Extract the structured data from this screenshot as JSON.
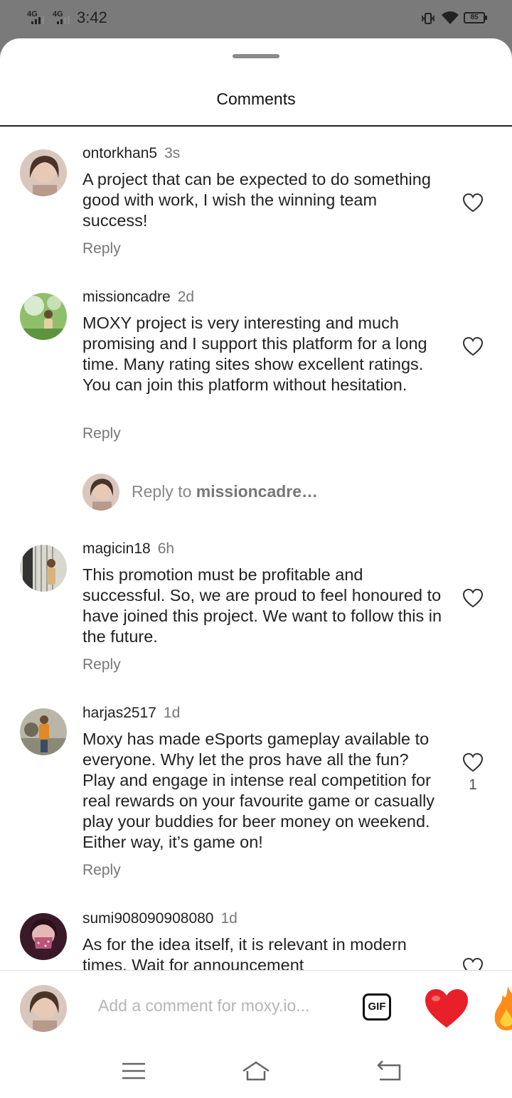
{
  "status_bar": {
    "network_1": "4G",
    "network_2": "4G",
    "time": "3:42",
    "battery": "85"
  },
  "sheet": {
    "title": "Comments"
  },
  "comments": [
    {
      "username": "ontorkhan5",
      "time": "3s",
      "text": "A project that can be expected to do something good with work, I wish the winning team success!",
      "reply_label": "Reply"
    },
    {
      "username": "missioncadre",
      "time": "2d",
      "text": "MOXY project is very interesting and much promising and I support this platform for a long time. Many rating sites show excellent ratings. You can join this platform without hesitation.",
      "reply_label": "Reply"
    },
    {
      "username": "magicin18",
      "time": "6h",
      "text": "This promotion must be profitable and successful. So, we are proud to feel honoured to have joined this project. We want to follow this in the future.",
      "reply_label": "Reply"
    },
    {
      "username": "harjas2517",
      "time": "1d",
      "text": "Moxy has made eSports gameplay available to everyone. Why let the pros have all the fun? Play and engage in intense real competition for real rewards on your favourite game or casually play your buddies for beer money on weekend. Either way, it’s game on!",
      "reply_label": "Reply",
      "likes": "1"
    },
    {
      "username": "sumi908090908080",
      "time": "1d",
      "text": "As for the idea itself, it is relevant in modern times. Wait for announcement"
    }
  ],
  "reply_prompt": {
    "prefix": "Reply to ",
    "target": "missioncadre…"
  },
  "compose": {
    "placeholder": "Add a comment for moxy.io...",
    "gif_label": "GIF"
  },
  "colors": {
    "backdrop": "#7a7a7a",
    "sheet": "#ffffff",
    "heart_emoji": "#e8202a",
    "fire_emoji": "#ff8c1a"
  },
  "icons": [
    "signal-icon",
    "vibrate-icon",
    "wifi-icon",
    "battery-icon",
    "heart-outline-icon",
    "gif-icon",
    "red-heart-emoji",
    "fire-emoji",
    "menu-icon",
    "home-icon",
    "back-icon"
  ]
}
